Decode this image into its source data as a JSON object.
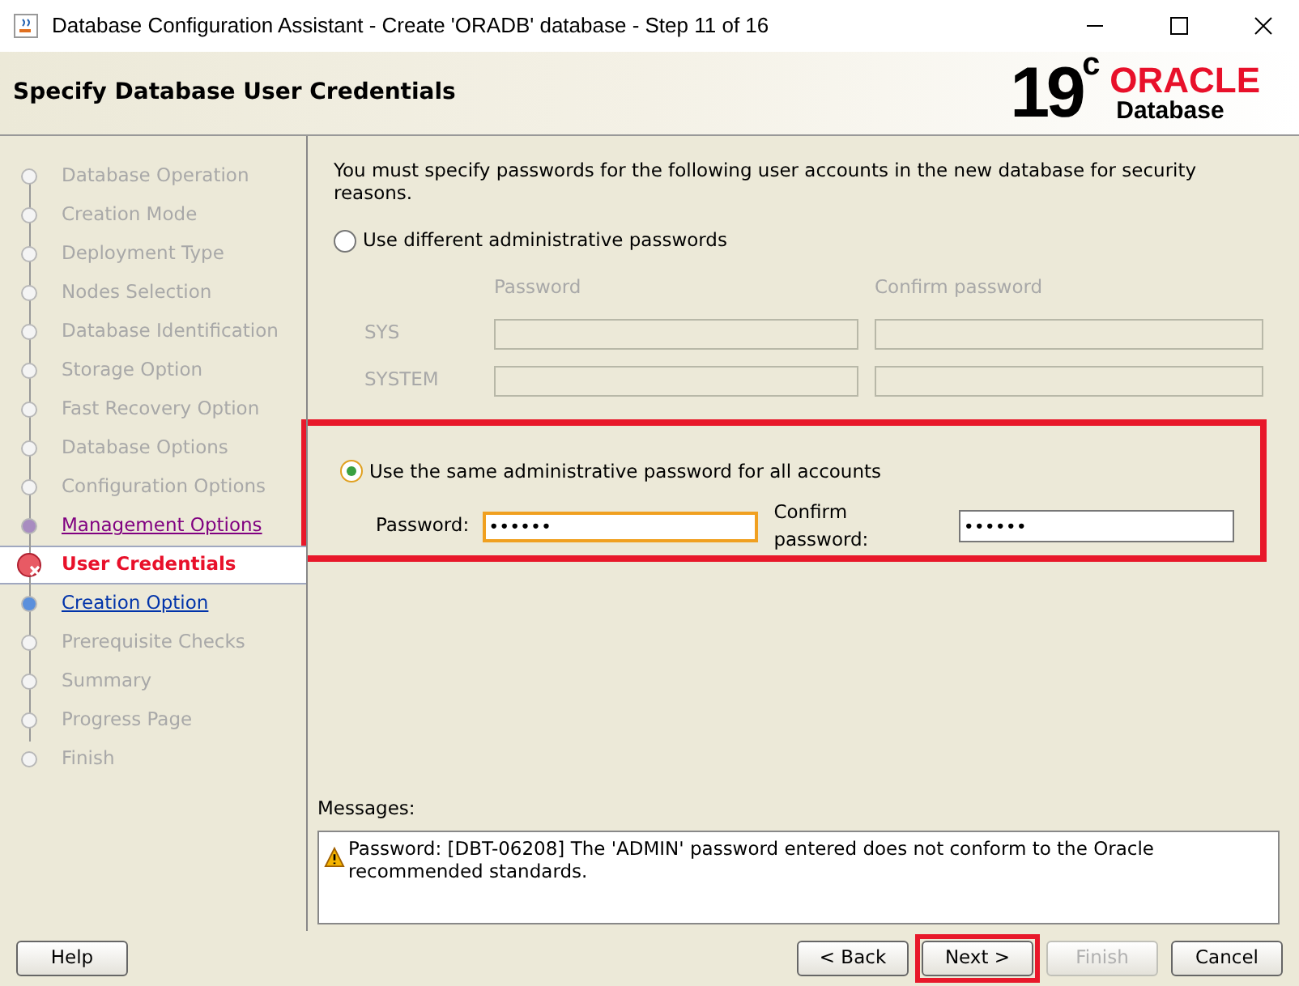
{
  "window": {
    "title": "Database Configuration Assistant - Create 'ORADB' database - Step 11 of 16"
  },
  "header": {
    "title": "Specify Database User Credentials",
    "version": "19",
    "version_suffix": "c",
    "brand": "ORACLE",
    "product": "Database"
  },
  "steps": [
    {
      "label": "Database Operation",
      "kind": "pending"
    },
    {
      "label": "Creation Mode",
      "kind": "pending"
    },
    {
      "label": "Deployment Type",
      "kind": "pending"
    },
    {
      "label": "Nodes Selection",
      "kind": "pending"
    },
    {
      "label": "Database Identification",
      "kind": "pending"
    },
    {
      "label": "Storage Option",
      "kind": "pending"
    },
    {
      "label": "Fast Recovery Option",
      "kind": "pending"
    },
    {
      "label": "Database Options",
      "kind": "pending"
    },
    {
      "label": "Configuration Options",
      "kind": "pending"
    },
    {
      "label": "Management Options",
      "kind": "visited"
    },
    {
      "label": "User Credentials",
      "kind": "current"
    },
    {
      "label": "Creation Option",
      "kind": "next"
    },
    {
      "label": "Prerequisite Checks",
      "kind": "pending"
    },
    {
      "label": "Summary",
      "kind": "pending"
    },
    {
      "label": "Progress Page",
      "kind": "pending"
    },
    {
      "label": "Finish",
      "kind": "pending"
    }
  ],
  "intro": "You must specify passwords for the following user accounts in the new database for security reasons.",
  "different_option": {
    "label": "Use different administrative passwords",
    "selected": false,
    "columns": [
      "Password",
      "Confirm password"
    ],
    "accounts": [
      {
        "name": "SYS",
        "disabled": true
      },
      {
        "name": "SYSTEM",
        "disabled": true
      }
    ]
  },
  "same_option": {
    "label": "Use the same administrative password for all accounts",
    "selected": true,
    "password_label": "Password:",
    "password_value": "••••••",
    "confirm_label": "Confirm password:",
    "confirm_value": "••••••"
  },
  "messages": {
    "label": "Messages:",
    "text": "Password: [DBT-06208] The 'ADMIN' password entered does not conform to the Oracle recommended standards."
  },
  "buttons": [
    {
      "label": "Help",
      "disabled": false
    },
    {
      "label": "< Back",
      "disabled": false
    },
    {
      "label": "Next >",
      "disabled": false
    },
    {
      "label": "Finish",
      "disabled": true
    },
    {
      "label": "Cancel",
      "disabled": false
    }
  ]
}
